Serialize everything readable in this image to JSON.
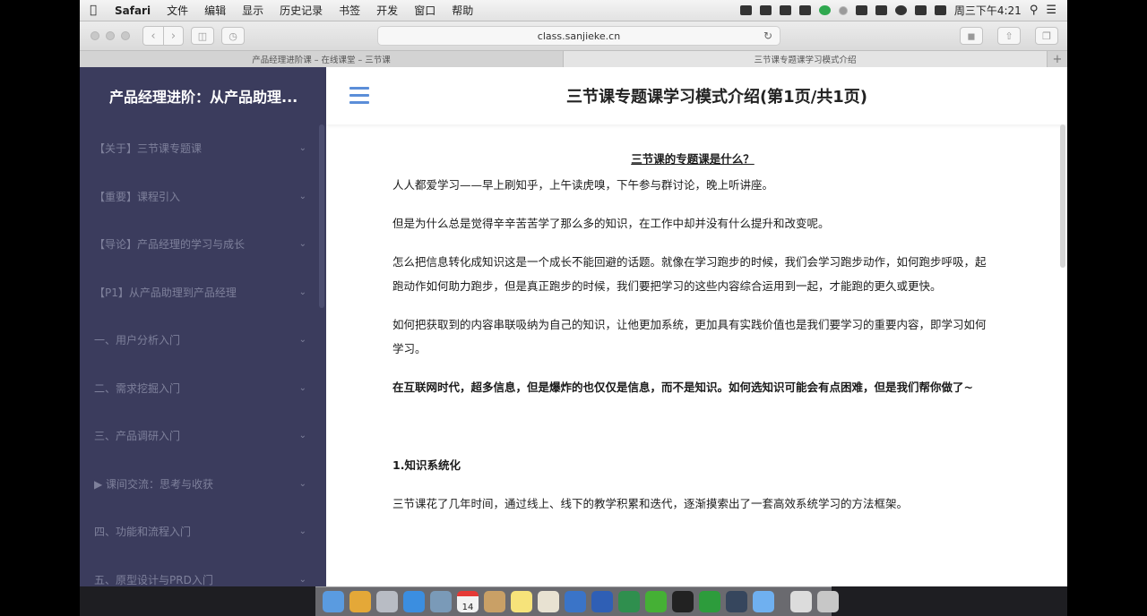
{
  "menubar": {
    "app_name": "Safari",
    "items": [
      "文件",
      "编辑",
      "显示",
      "历史记录",
      "书签",
      "开发",
      "窗口",
      "帮助"
    ],
    "clock": "周三下午4:21"
  },
  "browser": {
    "url": "class.sanjieke.cn",
    "tabs": [
      {
        "title": "产品经理进阶课 – 在线课堂 – 三节课"
      },
      {
        "title": "三节课专题课学习模式介绍"
      }
    ]
  },
  "sidebar": {
    "title": "产品经理进阶：从产品助理...",
    "items": [
      {
        "label": "【关于】三节课专题课"
      },
      {
        "label": "【重要】课程引入"
      },
      {
        "label": "【导论】产品经理的学习与成长"
      },
      {
        "label": "【P1】从产品助理到产品经理"
      },
      {
        "label": "一、用户分析入门"
      },
      {
        "label": "二、需求挖掘入门"
      },
      {
        "label": "三、产品调研入门"
      },
      {
        "label": "▶ 课间交流：思考与收获"
      },
      {
        "label": "四、功能和流程入门"
      },
      {
        "label": "五、原型设计与PRD入门"
      }
    ]
  },
  "main": {
    "title": "三节课专题课学习模式介绍(第1页/共1页)",
    "question": "三节课的专题课是什么？",
    "paragraphs": [
      "人人都爱学习——早上刷知乎，上午读虎嗅，下午参与群讨论，晚上听讲座。",
      "但是为什么总是觉得辛辛苦苦学了那么多的知识，在工作中却并没有什么提升和改变呢。",
      "怎么把信息转化成知识这是一个成长不能回避的话题。就像在学习跑步的时候，我们会学习跑步动作，如何跑步呼吸，起跑动作如何助力跑步，但是真正跑步的时候，我们要把学习的这些内容综合运用到一起，才能跑的更久或更快。",
      "如何把获取到的内容串联吸纳为自己的知识，让他更加系统，更加具有实践价值也是我们要学习的重要内容，即学习如何学习。"
    ],
    "bold_paragraph": "在互联网时代，超多信息，但是爆炸的也仅仅是信息，而不是知识。如何选知识可能会有点困难，但是我们帮你做了~",
    "section_heading": "1.知识系统化",
    "section_text": "三节课花了几年时间，通过线上、线下的教学积累和迭代，逐渐摸索出了一套高效系统学习的方法框架。"
  },
  "dock": {
    "calendar_day": "14",
    "icons": [
      "finder-icon",
      "chrome-icon",
      "launchpad-icon",
      "safari-icon",
      "preview-icon",
      "calendar-icon",
      "notes-icon",
      "stickies-icon",
      "textedit-icon",
      "keynote-icon",
      "word-icon",
      "excel-icon",
      "wechat-icon",
      "qq-icon",
      "evernote-icon",
      "tumblr-icon",
      "tweetbot-icon",
      "downloads-icon",
      "trash-icon"
    ],
    "colors": [
      "#5a9be0",
      "#e4a838",
      "#b8bcc4",
      "#3b8ee0",
      "#7a9ab8",
      "#f2f2f2",
      "#c9a066",
      "#f6e37a",
      "#e8e2d2",
      "#3a74c8",
      "#2f5fb5",
      "#2f8f4e",
      "#45b035",
      "#222222",
      "#2d9c3c",
      "#36465d",
      "#6fb0f0",
      "#dcdcdc",
      "#c7c7c7"
    ]
  }
}
